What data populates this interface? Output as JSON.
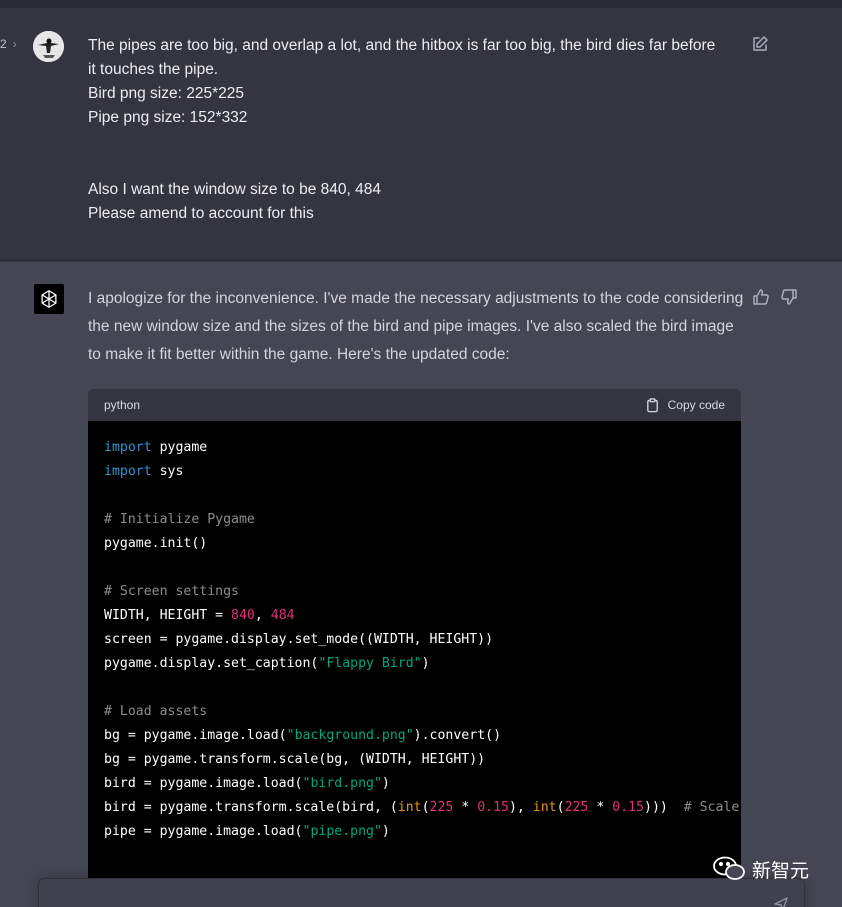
{
  "pager": {
    "label": "2"
  },
  "user_message": {
    "lines": [
      "The pipes are too big, and overlap a lot, and the hitbox is far too big, the bird dies far before",
      "it touches the pipe.",
      "Bird png size: 225*225",
      "Pipe png size: 152*332",
      "",
      "",
      "Also I want the window size to be  840, 484",
      "Please amend to account for this"
    ]
  },
  "assistant_message": {
    "text": "I apologize for the inconvenience. I've made the necessary adjustments to the code considering the new window size and the sizes of the bird and pipe images. I've also scaled the bird image to make it fit better within the game. Here's the updated code:"
  },
  "code_block": {
    "language": "python",
    "copy_label": "Copy code"
  },
  "watermark": {
    "text": "新智元"
  },
  "icons": {
    "edit": "edit-icon",
    "thumbs_up": "thumbs-up-icon",
    "thumbs_down": "thumbs-down-icon",
    "copy": "clipboard-icon",
    "send": "send-icon",
    "chevron": "chevron-right-icon"
  },
  "colors": {
    "user_bg": "#343541",
    "assistant_bg": "#444654",
    "code_bg": "#000000",
    "keyword": "#2e95d3",
    "comment": "#8c8c8c",
    "number": "#df3079",
    "string": "#00a67d",
    "builtin": "#e9950c"
  }
}
